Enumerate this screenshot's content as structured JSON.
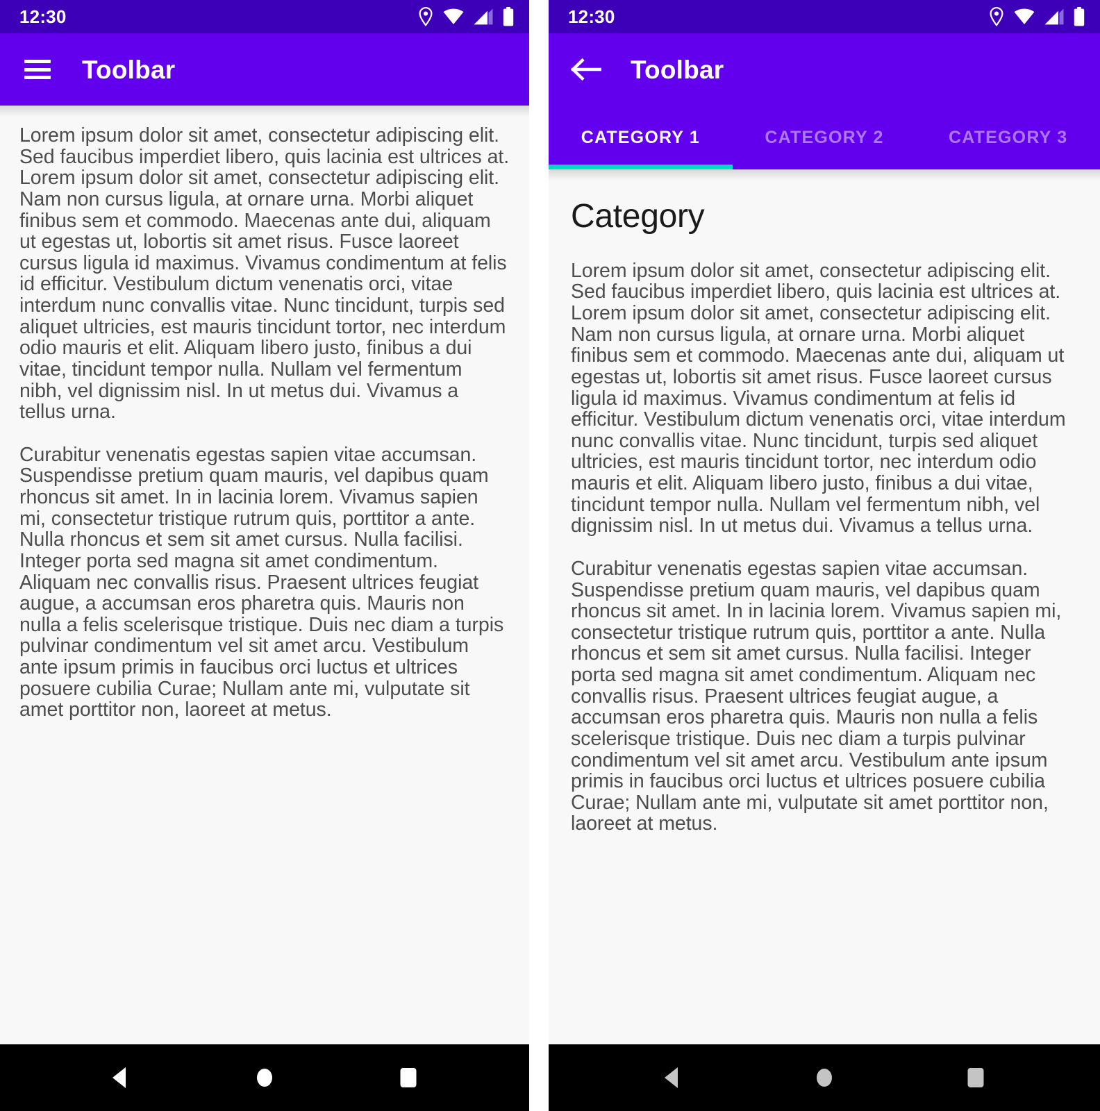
{
  "colors": {
    "status_bar": "#3d00b8",
    "toolbar": "#6200ee",
    "tab_indicator": "#03dac5",
    "content_bg": "#f8f8f8",
    "nav_bar": "#000000",
    "nav_icon_left": "#ffffff",
    "nav_icon_right": "#c4c4c4",
    "body_text": "#4d4d4d",
    "heading_text": "#1a1a1a"
  },
  "shared": {
    "status_time": "12:30",
    "toolbar_title": "Toolbar",
    "paragraph_1": "Lorem ipsum dolor sit amet, consectetur adipiscing elit. Sed faucibus imperdiet libero, quis lacinia est ultrices at. Lorem ipsum dolor sit amet, consectetur adipiscing elit. Nam non cursus ligula, at ornare urna. Morbi aliquet finibus sem et commodo. Maecenas ante dui, aliquam ut egestas ut, lobortis sit amet risus. Fusce laoreet cursus ligula id maximus. Vivamus condimentum at felis id efficitur. Vestibulum dictum venenatis orci, vitae interdum nunc convallis vitae. Nunc tincidunt, turpis sed aliquet ultricies, est mauris tincidunt tortor, nec interdum odio mauris et elit. Aliquam libero justo, finibus a dui vitae, tincidunt tempor nulla. Nullam vel fermentum nibh, vel dignissim nisl. In ut metus dui. Vivamus a tellus urna.",
    "paragraph_2": "Curabitur venenatis egestas sapien vitae accumsan. Suspendisse pretium quam mauris, vel dapibus quam rhoncus sit amet. In in lacinia lorem. Vivamus sapien mi, consectetur tristique rutrum quis, porttitor a ante. Nulla rhoncus et sem sit amet cursus. Nulla facilisi. Integer porta sed magna sit amet condimentum. Aliquam nec convallis risus. Praesent ultrices feugiat augue, a accumsan eros pharetra quis. Mauris non nulla a felis scelerisque tristique. Duis nec diam a turpis pulvinar condimentum vel sit amet arcu. Vestibulum ante ipsum primis in faucibus orci luctus et ultrices posuere cubilia Curae; Nullam ante mi, vulputate sit amet porttitor non, laoreet at metus."
  },
  "status_icons": [
    {
      "name": "location-icon"
    },
    {
      "name": "wifi-icon"
    },
    {
      "name": "cellular-signal-icon"
    },
    {
      "name": "battery-icon"
    }
  ],
  "left_screen": {
    "status_time": "12:30",
    "menu_icon": "hamburger-menu-icon",
    "toolbar_title": "Toolbar"
  },
  "right_screen": {
    "status_time": "12:30",
    "back_icon": "back-arrow-icon",
    "toolbar_title": "Toolbar",
    "page_heading": "Category",
    "tabs": [
      {
        "label": "CATEGORY 1",
        "active": true
      },
      {
        "label": "CATEGORY 2",
        "active": false
      },
      {
        "label": "CATEGORY 3",
        "active": false
      }
    ]
  },
  "nav_bar": {
    "back": "nav-back-icon",
    "home": "nav-home-icon",
    "recents": "nav-recents-icon"
  }
}
